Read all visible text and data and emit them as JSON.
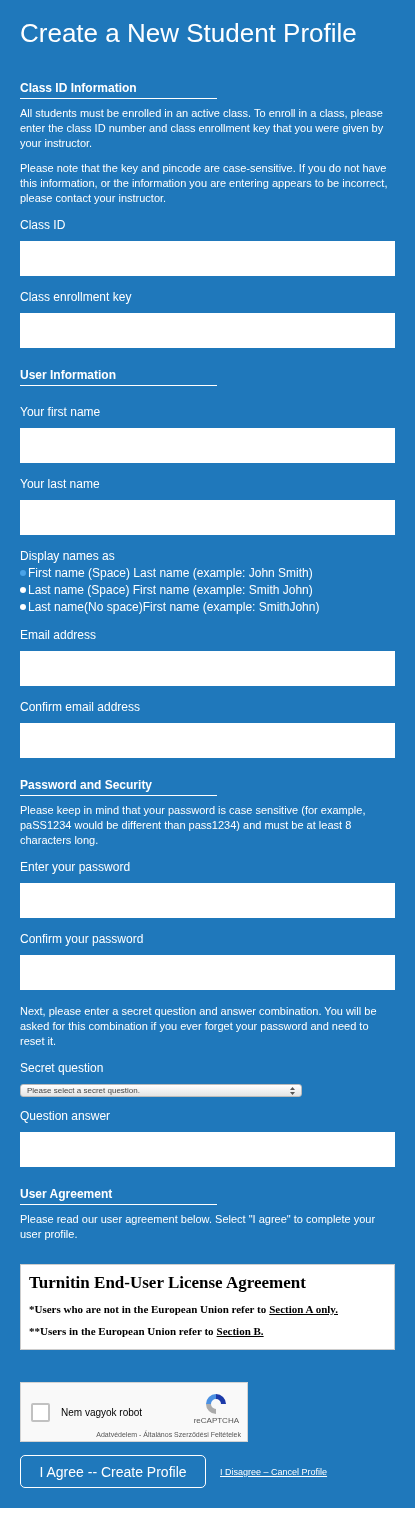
{
  "title": "Create a New Student Profile",
  "blocks": [
    {
      "kind": "heading",
      "text": "Class ID Information"
    },
    {
      "kind": "paragraph",
      "text": "All students must be enrolled in an active class. To enroll in a class, please enter the class ID number and class enrollment key that you were given by your instructor."
    },
    {
      "kind": "paragraph",
      "text": "Please note that the key and pincode are case-sensitive. If you do not have this information, or the information you are entering appears to be incorrect, please contact your instructor."
    },
    {
      "kind": "field",
      "label": "Class ID"
    },
    {
      "kind": "field",
      "label": "Class enrollment key"
    },
    {
      "kind": "heading",
      "text": "User Information"
    },
    {
      "kind": "field",
      "label": "Your first name"
    },
    {
      "kind": "field",
      "label": "Your last name"
    },
    {
      "kind": "radios",
      "label": "Display names as",
      "options": [
        {
          "text": "First name (Space) Last name (example: John Smith)",
          "selected": true
        },
        {
          "text": "Last name (Space) First name (example: Smith John)",
          "selected": false
        },
        {
          "text": "Last name(No space)First name (example: SmithJohn)",
          "selected": false
        }
      ]
    },
    {
      "kind": "field",
      "label": "Email address"
    },
    {
      "kind": "field",
      "label": "Confirm email address"
    },
    {
      "kind": "heading",
      "text": "Password and Security"
    },
    {
      "kind": "paragraph",
      "text": "Please keep in mind that your password is case sensitive (for example, paSS1234 would be different than pass1234) and must be at least 8 characters long."
    },
    {
      "kind": "field",
      "label": "Enter your password"
    },
    {
      "kind": "field",
      "label": "Confirm your password"
    },
    {
      "kind": "paragraph",
      "text": "Next, please enter a secret question and answer combination. You will be asked for this combination if you ever forget your password and need to reset it."
    },
    {
      "kind": "select",
      "label": "Secret question",
      "value": "Please select a secret question."
    },
    {
      "kind": "field",
      "label": "Question answer"
    },
    {
      "kind": "heading",
      "text": "User Agreement"
    },
    {
      "kind": "paragraph",
      "text": "Please read our user agreement below. Select \"I agree\" to complete your user profile."
    }
  ],
  "agreement": {
    "title": "Turnitin End-User License Agreement",
    "lines": [
      {
        "text": "*Users who are not in the European Union refer to",
        "link": "Section A only."
      },
      {
        "text": "**Users in the European Union refer to",
        "link": "Section B."
      }
    ]
  },
  "captcha": {
    "checked": false,
    "label": "Nem vagyok robot",
    "brand": "reCAPTCHA",
    "footer": "Adatvédelem - Általános Szerződési Feltételek"
  },
  "actions": {
    "agree": "I Agree -- Create Profile",
    "disagree": "I Disagree – Cancel Profile"
  }
}
